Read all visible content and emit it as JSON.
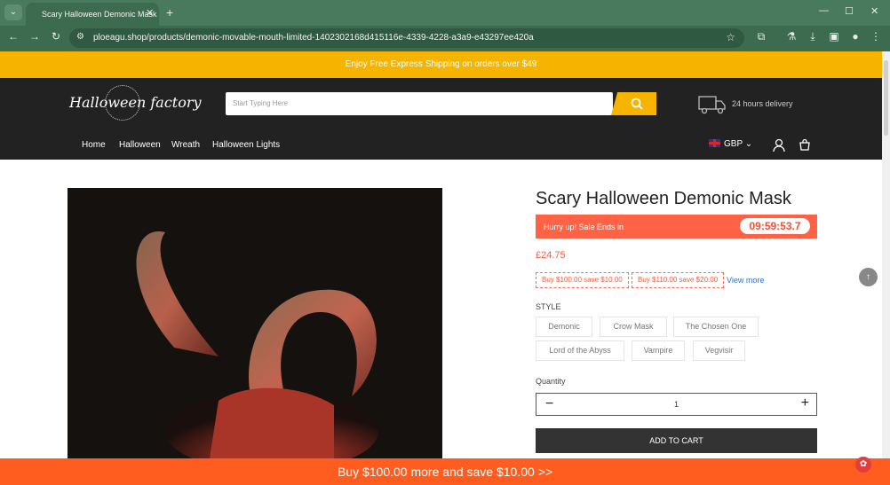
{
  "browser": {
    "tab_title": "Scary Halloween Demonic Mask",
    "url": "ploeagu.shop/products/demonic-movable-mouth-limited-1402302168d415116e-4339-4228-a3a9-e43297ee420a"
  },
  "promo": {
    "text": "Enjoy Free Express Shipping on orders over $49"
  },
  "header": {
    "logo_text": "Halloween factory",
    "search_placeholder": "Start Typing Here",
    "delivery_text": "24 hours delivery",
    "menu": [
      "Home",
      "Halloween",
      "Wreath",
      "Halloween Lights"
    ],
    "currency": "GBP"
  },
  "product": {
    "title": "Scary Halloween Demonic Mask",
    "sale_text": "Hurry up! Sale Ends in",
    "timer": "09:59:53.7",
    "price": "£24.75",
    "coupons": [
      "Buy $100.00 save $10.00",
      "Buy $110.00 save $20.00"
    ],
    "view_more": "View more",
    "style_label": "STYLE",
    "styles": [
      "Demonic",
      "Crow Mask",
      "The Chosen One",
      "Lord of the Abyss",
      "Vampire",
      "Vegvisir"
    ],
    "quantity_label": "Quantity",
    "quantity": "1",
    "add_to_cart": "ADD TO CART"
  },
  "bottom_banner": {
    "text": "Buy $100.00 more and save $10.00  >>"
  }
}
